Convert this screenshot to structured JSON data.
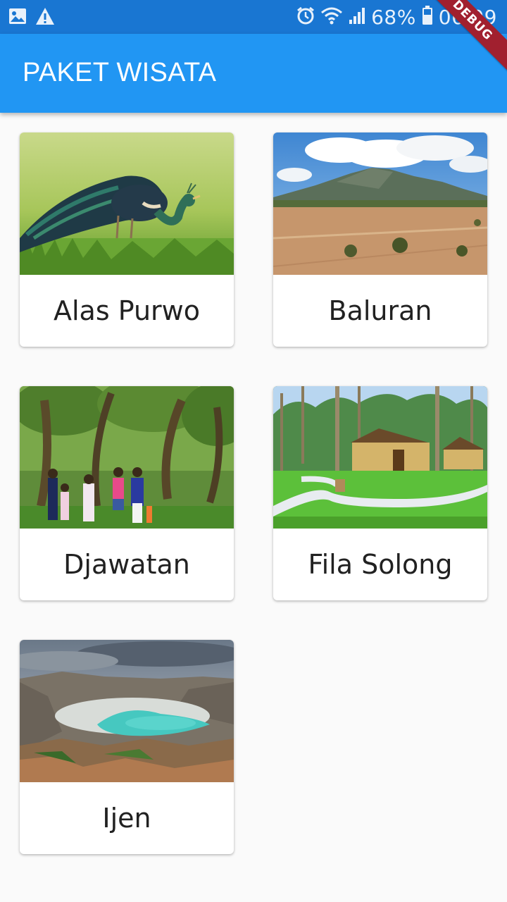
{
  "status_bar": {
    "battery": "68%",
    "time": "06:09",
    "icons": [
      "image-icon",
      "warning-icon",
      "alarm-icon",
      "wifi-icon",
      "signal-icon",
      "battery-icon"
    ]
  },
  "app_bar": {
    "title": "PAKET WISATA",
    "color": "#2196f3"
  },
  "debug_banner": "DEBUG",
  "packages": [
    {
      "name": "Alas Purwo",
      "image": "peacock-photo"
    },
    {
      "name": "Baluran",
      "image": "savanna-mountain-photo"
    },
    {
      "name": "Djawatan",
      "image": "forest-group-photo"
    },
    {
      "name": "Fila Solong",
      "image": "resort-palm-photo"
    },
    {
      "name": "Ijen",
      "image": "crater-lake-photo"
    }
  ]
}
